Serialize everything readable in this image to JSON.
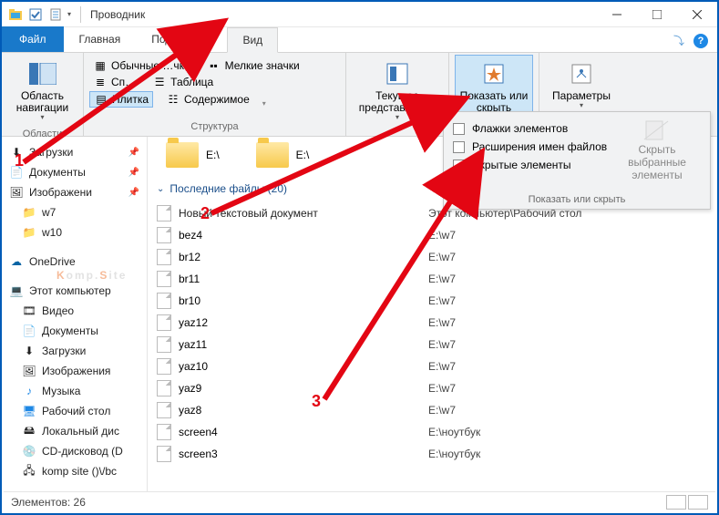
{
  "window": {
    "title": "Проводник"
  },
  "tabs": {
    "file": "Файл",
    "home": "Главная",
    "share": "Поделиться",
    "view": "Вид",
    "minribbon_icon": "˄"
  },
  "ribbon": {
    "nav_pane": {
      "label": "Область навигации",
      "group": "Области"
    },
    "layout": {
      "tiny": "Обычные …чки",
      "list": "Сп…",
      "tiles": "Плитка",
      "small": "Мелкие значки",
      "table": "Таблица",
      "content": "Содержимое",
      "group": "Структура"
    },
    "current_view": {
      "label": "Текущее представление"
    },
    "show_hide": {
      "label": "Показать или скрыть"
    },
    "options": {
      "label": "Параметры"
    }
  },
  "dropdown": {
    "chk_flags": "Флажки элементов",
    "chk_ext": "Расширения имен файлов",
    "chk_hidden": "Скрытые элементы",
    "hide_selected": "Скрыть выбранные элементы",
    "footer": "Показать или скрыть"
  },
  "nav": {
    "downloads": "Загрузки",
    "documents": "Документы",
    "pictures": "Изображени",
    "w7": "w7",
    "w10": "w10",
    "onedrive": "OneDrive",
    "thispc": "Этот компьютер",
    "videos": "Видео",
    "documents2": "Документы",
    "downloads2": "Загрузки",
    "pictures2": "Изображения",
    "music": "Музыка",
    "desktop": "Рабочий стол",
    "localdisk": "Локальный дис",
    "cd": "CD-дисковод (D",
    "komp": "komp site ()\\/bc"
  },
  "folders": {
    "e1": "E:\\",
    "e2": "E:\\"
  },
  "recent": {
    "header": "Последние файлы (20)",
    "name_col": "Новый текстовый документ",
    "loc_col": "Этот компьютер\\Рабочий стол",
    "rows": [
      {
        "name": "bez4",
        "loc": "E:\\w7"
      },
      {
        "name": "br12",
        "loc": "E:\\w7"
      },
      {
        "name": "br11",
        "loc": "E:\\w7"
      },
      {
        "name": "br10",
        "loc": "E:\\w7"
      },
      {
        "name": "yaz12",
        "loc": "E:\\w7"
      },
      {
        "name": "yaz11",
        "loc": "E:\\w7"
      },
      {
        "name": "yaz10",
        "loc": "E:\\w7"
      },
      {
        "name": "yaz9",
        "loc": "E:\\w7"
      },
      {
        "name": "yaz8",
        "loc": "E:\\w7"
      },
      {
        "name": "screen4",
        "loc": "E:\\ноутбук"
      },
      {
        "name": "screen3",
        "loc": "E:\\ноутбук"
      }
    ]
  },
  "status": {
    "count_label": "Элементов:",
    "count": "26"
  },
  "watermark": {
    "k": "K",
    "omp": "omp.",
    "s": "S",
    "ite": "ite"
  },
  "markers": {
    "m1": "1",
    "m2": "2",
    "m3": "3"
  }
}
